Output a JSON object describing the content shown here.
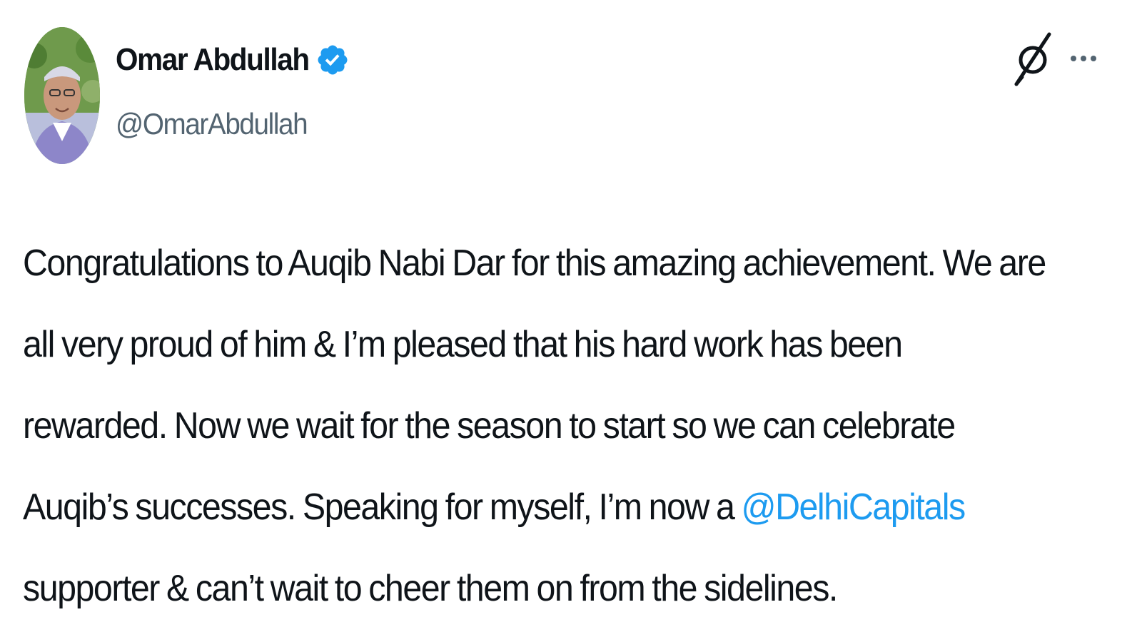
{
  "author": {
    "display_name": "Omar Abdullah",
    "handle": "@OmarAbdullah",
    "verified": true,
    "verified_color": "#1d9bf0"
  },
  "actions": {
    "grok_icon": "grok-icon",
    "more_icon": "more-horizontal-icon"
  },
  "tweet": {
    "lines": [
      "Congratulations to Auqib Nabi Dar for this amazing achievement. We are",
      "all very proud of him & I’m pleased that his hard work has been",
      "rewarded. Now we wait for the season to start so we can celebrate"
    ],
    "line4_before": "Auqib’s successes. Speaking for myself, I’m now a ",
    "mention": "@DelhiCapitals",
    "line5": "supporter & can’t wait to cheer them on from the sidelines."
  },
  "colors": {
    "text": "#0f1419",
    "secondary": "#536471",
    "link": "#1d9bf0"
  }
}
